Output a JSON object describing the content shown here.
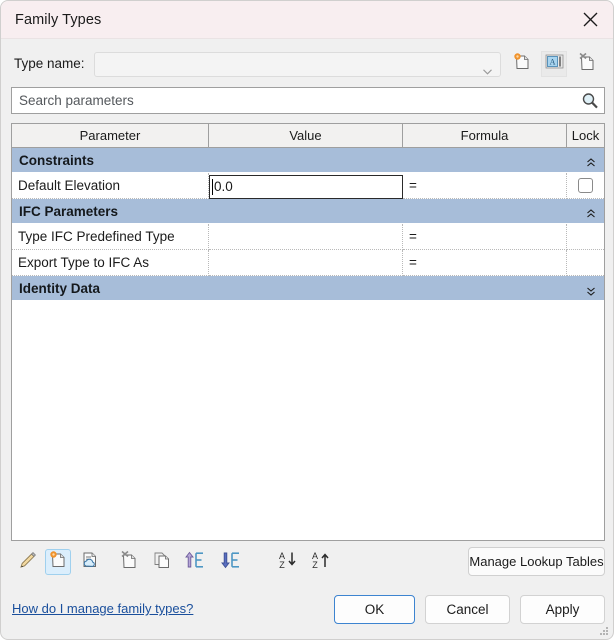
{
  "window": {
    "title": "Family Types",
    "close_icon": "close-icon"
  },
  "type_name": {
    "label": "Type name:",
    "value": "",
    "placeholder": "",
    "dropdown_icon": "chevron-down-icon",
    "actions": [
      {
        "name": "new-type-icon",
        "tooltip": "New Type"
      },
      {
        "name": "rename-type-icon",
        "tooltip": "Rename Type"
      },
      {
        "name": "delete-type-icon",
        "tooltip": "Delete Type"
      }
    ]
  },
  "search": {
    "placeholder": "Search parameters",
    "value": "",
    "icon": "search-icon"
  },
  "table": {
    "columns": [
      "Parameter",
      "Value",
      "Formula",
      "Lock"
    ],
    "groups": [
      {
        "title": "Constraints",
        "collapsed": false,
        "chevron": "chevron-up-icon",
        "rows": [
          {
            "parameter": "Default Elevation",
            "value": "0.0",
            "formula": "=",
            "lock": true,
            "editing": true
          }
        ]
      },
      {
        "title": "IFC Parameters",
        "collapsed": false,
        "chevron": "chevron-up-icon",
        "rows": [
          {
            "parameter": "Type IFC Predefined Type",
            "value": "",
            "formula": "=",
            "lock": false,
            "editing": false
          },
          {
            "parameter": "Export Type to IFC As",
            "value": "",
            "formula": "=",
            "lock": false,
            "editing": false
          }
        ]
      },
      {
        "title": "Identity Data",
        "collapsed": true,
        "chevron": "chevron-down-icon",
        "rows": []
      }
    ]
  },
  "toolbar": {
    "icons": [
      {
        "name": "edit-parameter-icon",
        "tooltip": "Modify",
        "selected": false
      },
      {
        "name": "new-parameter-icon",
        "tooltip": "New Parameter",
        "selected": true
      },
      {
        "name": "shared-parameter-icon",
        "tooltip": "Shared Parameter",
        "selected": false
      },
      {
        "name": "remove-parameter-icon",
        "tooltip": "Remove Parameter",
        "selected": false
      },
      {
        "name": "duplicate-parameter-icon",
        "tooltip": "Duplicate",
        "selected": false
      },
      {
        "name": "move-up-icon",
        "tooltip": "Move Up",
        "selected": false
      },
      {
        "name": "move-down-icon",
        "tooltip": "Move Down",
        "selected": false
      },
      {
        "name": "sort-ascending-icon",
        "tooltip": "Sort Ascending",
        "selected": false
      },
      {
        "name": "sort-descending-icon",
        "tooltip": "Sort Descending",
        "selected": false
      }
    ],
    "manage_lookup_tables_label": "Manage Lookup Tables"
  },
  "footer": {
    "help_link": "How do I manage family types?",
    "ok_label": "OK",
    "cancel_label": "Cancel",
    "apply_label": "Apply"
  },
  "colors": {
    "titlebar": "#f8eef0",
    "group_header": "#a7bdd9",
    "accent_default_button": "#3d84d0",
    "link": "#1a4f9c",
    "selected_toolbar": "#dbeefc"
  }
}
